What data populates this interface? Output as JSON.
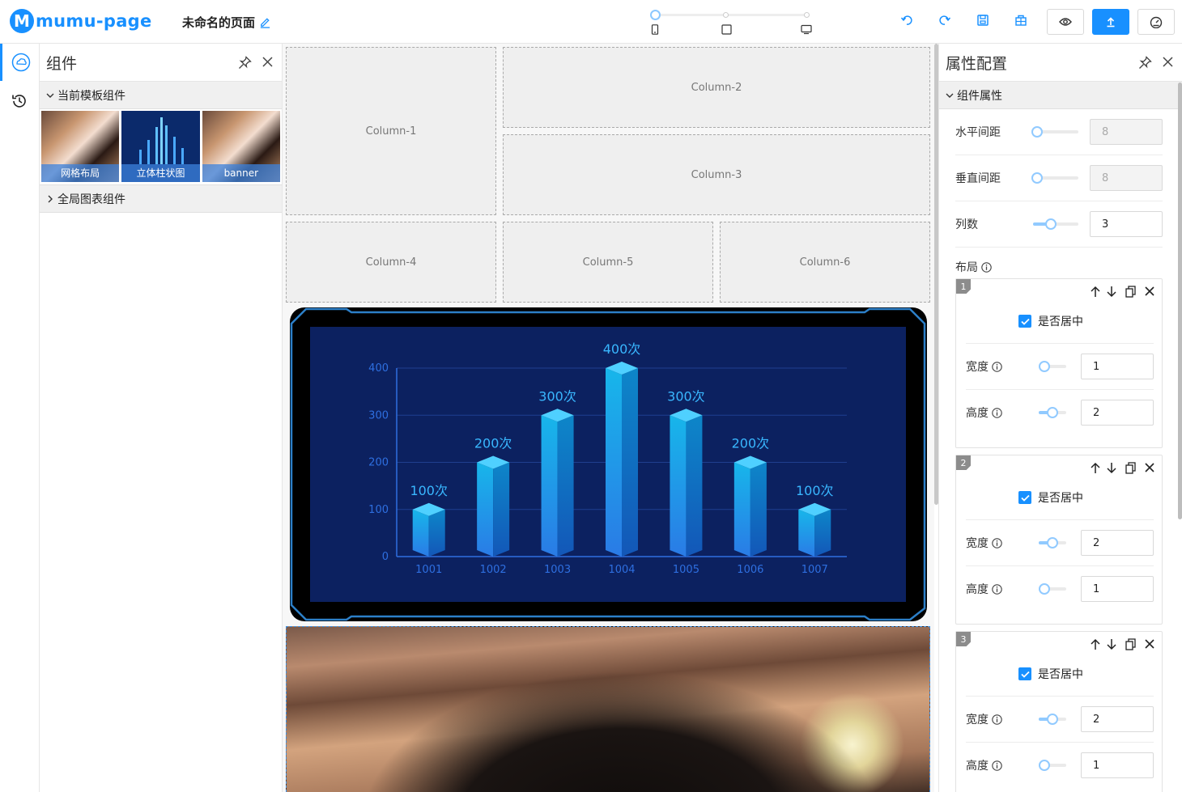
{
  "app": {
    "logo_letter": "M",
    "logo_text": "mumu-page",
    "page_title": "未命名的页面"
  },
  "header": {
    "devices": [
      "mobile-icon",
      "tablet-icon",
      "desktop-icon"
    ],
    "toolbar_icons": [
      "undo-icon",
      "redo-icon",
      "save-icon",
      "template-icon"
    ],
    "buttons": [
      "eye-icon",
      "publish-icon",
      "dashboard-icon"
    ],
    "accent": "#1890ff"
  },
  "components_panel": {
    "title": "组件",
    "section_current": "当前模板组件",
    "thumbnails": [
      {
        "label": "网格布局"
      },
      {
        "label": "立体柱状图"
      },
      {
        "label": "banner"
      }
    ],
    "section_global": "全局图表组件"
  },
  "canvas": {
    "columns": [
      "Column-1",
      "Column-2",
      "Column-3",
      "Column-4",
      "Column-5",
      "Column-6"
    ]
  },
  "chart_data": {
    "type": "bar",
    "categories": [
      "1001",
      "1002",
      "1003",
      "1004",
      "1005",
      "1006",
      "1007"
    ],
    "values": [
      100,
      200,
      300,
      400,
      300,
      200,
      100
    ],
    "data_labels": [
      "100次",
      "200次",
      "300次",
      "400次",
      "300次",
      "200次",
      "100次"
    ],
    "y_ticks": [
      "0",
      "100",
      "200",
      "300",
      "400"
    ],
    "ylim": [
      0,
      400
    ],
    "grid": true,
    "colors": {
      "background": "#0c2160",
      "bar_front": "#1aa9e6",
      "bar_side": "#0d74bf",
      "bar_top": "#4fd0ff",
      "axis": "#2e6fe0",
      "label": "#39b7ff"
    }
  },
  "props_panel": {
    "title": "属性配置",
    "section": "组件属性",
    "h_gap": {
      "label": "水平间距",
      "value": "8"
    },
    "v_gap": {
      "label": "垂直间距",
      "value": "8"
    },
    "cols": {
      "label": "列数",
      "value": "3"
    },
    "layout_label": "布局",
    "cards": [
      {
        "index": "1",
        "center_label": "是否居中",
        "width_label": "宽度",
        "width": "1",
        "height_label": "高度",
        "height": "2"
      },
      {
        "index": "2",
        "center_label": "是否居中",
        "width_label": "宽度",
        "width": "2",
        "height_label": "高度",
        "height": "1"
      },
      {
        "index": "3",
        "center_label": "是否居中",
        "width_label": "宽度",
        "width": "2",
        "height_label": "高度",
        "height": "1"
      }
    ]
  }
}
